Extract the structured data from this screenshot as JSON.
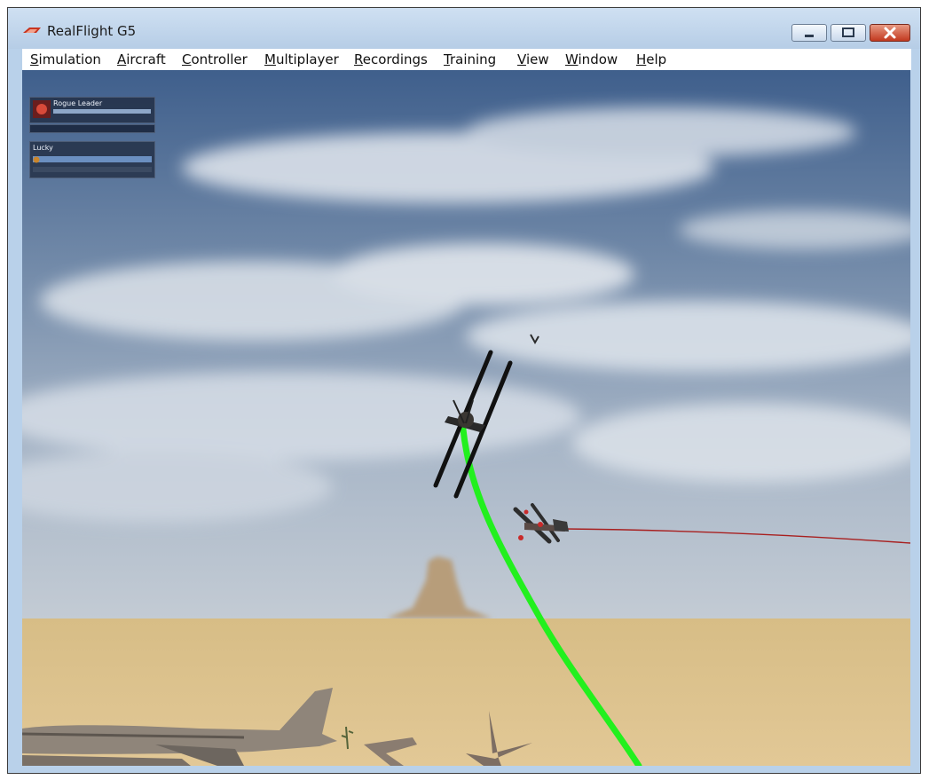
{
  "window": {
    "title": "RealFlight G5",
    "controls": {
      "minimize_icon": "minimize-icon",
      "maximize_icon": "maximize-icon",
      "close_icon": "close-icon"
    }
  },
  "menu": {
    "items": [
      {
        "label": "Simulation",
        "mnemonic": "S"
      },
      {
        "label": "Aircraft",
        "mnemonic": "A"
      },
      {
        "label": "Controller",
        "mnemonic": "C"
      },
      {
        "label": "Multiplayer",
        "mnemonic": "M"
      },
      {
        "label": "Recordings",
        "mnemonic": "R"
      },
      {
        "label": "Training",
        "mnemonic": "T"
      },
      {
        "label": "View",
        "mnemonic": "V"
      },
      {
        "label": "Window",
        "mnemonic": "W"
      },
      {
        "label": "Help",
        "mnemonic": "H"
      }
    ]
  },
  "hud": {
    "leader": {
      "name": "Rogue Leader"
    },
    "player": {
      "name": "Lucky",
      "health_fraction": 1.0
    }
  },
  "colors": {
    "smoke_trail": "#22f01e",
    "tracer": "#b02020",
    "sky_top": "#4a6b95",
    "sky_horizon": "#bcc7d3",
    "ground": "#d9bf88"
  }
}
